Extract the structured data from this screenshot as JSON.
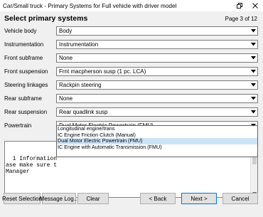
{
  "window": {
    "title": "Car/Small truck - Primary Systems for Full vehicle with driver model",
    "restore_icon": "restore-icon",
    "close_icon": "close-icon"
  },
  "header": {
    "heading": "Select primary systems",
    "page_indicator": "Page 3 of 12"
  },
  "rows": [
    {
      "label": "Vehicle body",
      "value": "Body"
    },
    {
      "label": "Instrumentation",
      "value": "Instrumentation"
    },
    {
      "label": "Front subframe",
      "value": "None"
    },
    {
      "label": "Front suspension",
      "value": "Frnt macpherson susp (1 pc. LCA)"
    },
    {
      "label": "Steering linkages",
      "value": "Rackpin steering"
    },
    {
      "label": "Rear subframe",
      "value": "None"
    },
    {
      "label": "Rear suspension",
      "value": "Rear quadlink susp"
    },
    {
      "label": "Powertrain",
      "value": "Dual Motor Electric Powertrain (FMU)"
    }
  ],
  "powertrain_options": [
    "Longitudinal engine/trans",
    "IC Engine Friction Clutch (Manual)",
    "Dual Motor Electric Powertrain (FMU)",
    "IC Engine with Automatic Transmission (FMU)"
  ],
  "selected_option_index": 2,
  "log": {
    "lines": [
      "  1 Information",
      "ase make sure t",
      "Manager"
    ]
  },
  "buttons": {
    "reset": "Reset Selection",
    "message_log": "Message Log...",
    "clear": "Clear",
    "back": "< Back",
    "next": "Next >",
    "cancel": "Cancel"
  }
}
